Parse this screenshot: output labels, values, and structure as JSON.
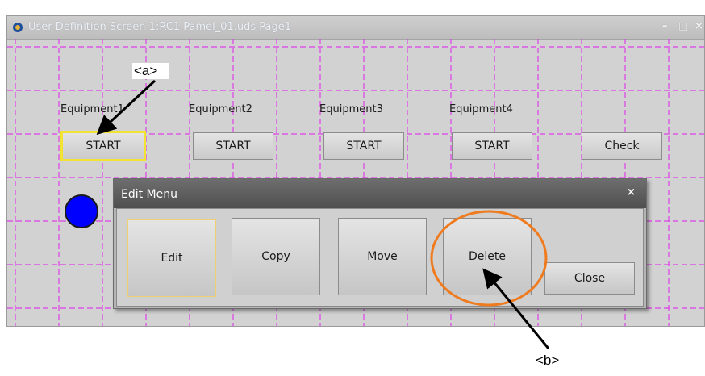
{
  "window": {
    "title": "User Definition Screen 1:RC1 Pamel_01.uds Page1",
    "icon": "app-icon",
    "controls": {
      "minimize": "–",
      "maximize": "□",
      "close": "×"
    }
  },
  "canvas": {
    "grid_color": "#e040e8",
    "equipment": [
      {
        "label": "Equipment1",
        "button": "START"
      },
      {
        "label": "Equipment2",
        "button": "START"
      },
      {
        "label": "Equipment3",
        "button": "START"
      },
      {
        "label": "Equipment4",
        "button": "START"
      }
    ],
    "check_button": "Check",
    "lamp_color": "#0000ff"
  },
  "edit_menu": {
    "title": "Edit Menu",
    "close_glyph": "×",
    "buttons": {
      "edit": "Edit",
      "copy": "Copy",
      "move": "Move",
      "delete": "Delete"
    },
    "close_button": "Close"
  },
  "callouts": {
    "a": "<a>",
    "b": "<b>",
    "highlight_color": "#ef7b1e"
  }
}
